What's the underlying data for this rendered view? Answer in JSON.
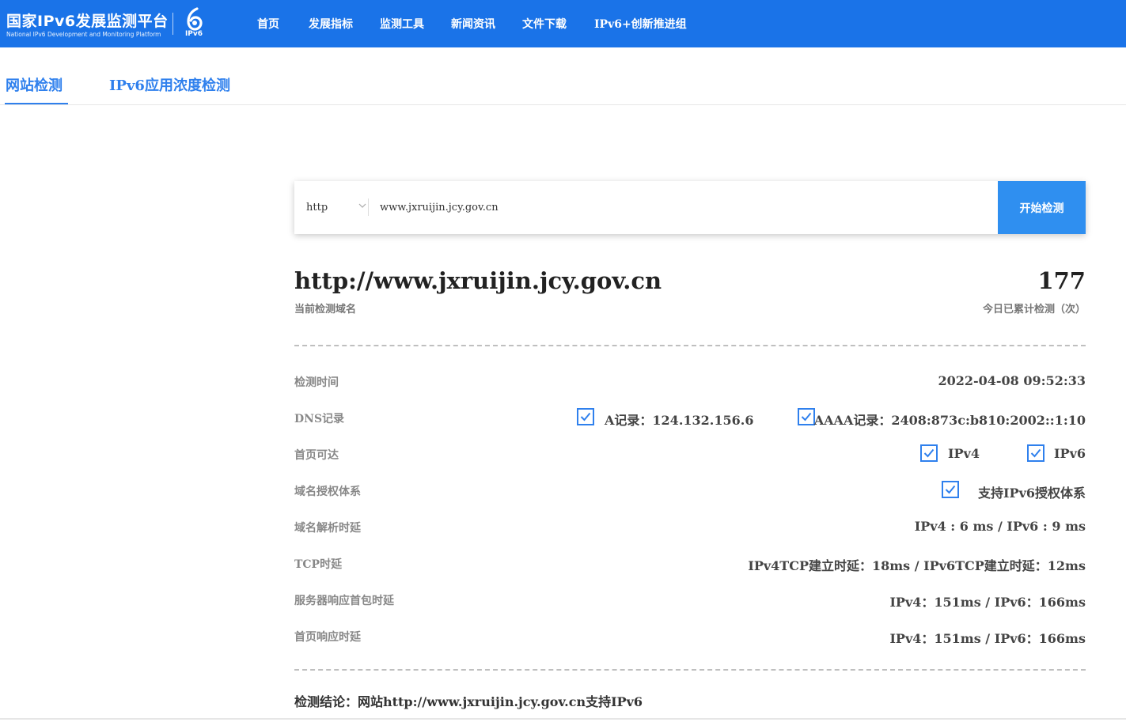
{
  "header": {
    "logo_cn": "国家IPv6发展监测平台",
    "logo_en": "National IPv6 Development and Monitoring Platform",
    "logo_mark_text": "IPv6",
    "nav": [
      "首页",
      "发展指标",
      "监测工具",
      "新闻资讯",
      "文件下载",
      "IPv6+创新推进组"
    ],
    "color": "#1a73e8"
  },
  "tabs": [
    "网站检测",
    "IPv6应用浓度检测"
  ],
  "search": {
    "protocol": "http",
    "value": "www.jxruijin.jcy.gov.cn",
    "button": "开始检测"
  },
  "result": {
    "domain": "http://www.jxruijin.jcy.gov.cn",
    "domain_caption": "当前检测域名",
    "count": "177",
    "count_caption": "今日已累计检测（次）",
    "rows": {
      "time": {
        "label": "检测时间",
        "value": "2022-04-08 09:52:33"
      },
      "dns": {
        "label": "DNS记录",
        "a": "A记录：124.132.156.6",
        "aaaa": "AAAA记录：2408:873c:b810:2002::1:10"
      },
      "reach": {
        "label": "首页可达",
        "ipv4": "IPv4",
        "ipv6": "IPv6"
      },
      "auth": {
        "label": "域名授权体系",
        "value": "支持IPv6授权体系"
      },
      "resolve": {
        "label": "域名解析时延",
        "value": "IPv4 : 6 ms / IPv6 : 9 ms"
      },
      "tcp": {
        "label": "TCP时延",
        "value": "IPv4TCP建立时延：18ms / IPv6TCP建立时延：12ms"
      },
      "first_packet": {
        "label": "服务器响应首包时延",
        "value": "IPv4：151ms / IPv6：166ms"
      },
      "page": {
        "label": "首页响应时延",
        "value": "IPv4：151ms / IPv6：166ms"
      }
    },
    "conclusion": "检测结论：网站http://www.jxruijin.jcy.gov.cn支持IPv6"
  },
  "colors": {
    "accent": "#2f80ed",
    "button": "#2f8ff0"
  }
}
